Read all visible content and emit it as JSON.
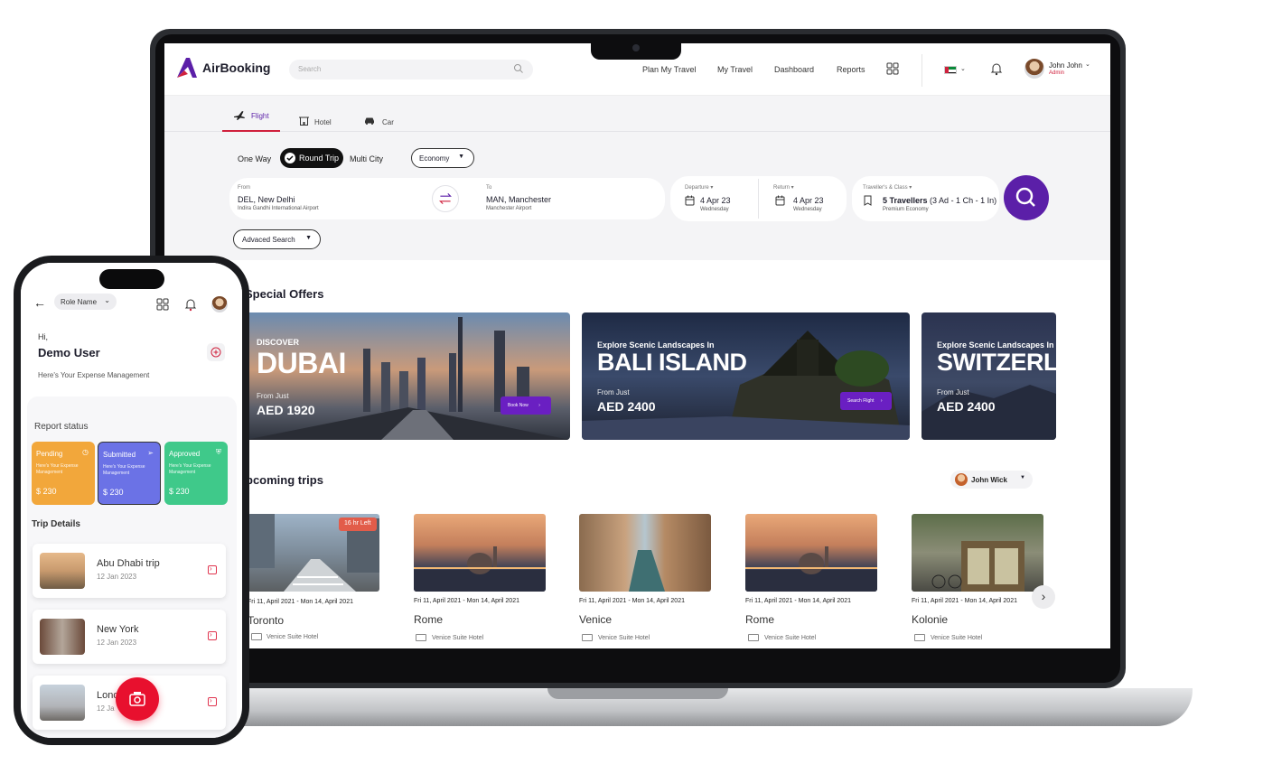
{
  "brand": {
    "name": "AirBooking",
    "accent": "#5b1fa8",
    "red": "#d0213d"
  },
  "header": {
    "search_placeholder": "Search",
    "nav": [
      "Plan My Travel",
      "My Travel",
      "Dashboard",
      "Reports"
    ],
    "user_name": "John John",
    "user_role": "Admin"
  },
  "tabs": [
    {
      "label": "Flight",
      "icon": "plane-icon",
      "active": true
    },
    {
      "label": "Hotel",
      "icon": "hotel-icon"
    },
    {
      "label": "Car",
      "icon": "car-icon"
    }
  ],
  "trip_types": {
    "one_way": "One Way",
    "round_trip": "Round Trip",
    "multi_city": "Multi City",
    "selected": "Round Trip"
  },
  "cabin": "Economy",
  "from": {
    "label": "From",
    "code_city": "DEL, New Delhi",
    "airport": "Indira Gandhi International Airport"
  },
  "to": {
    "label": "To",
    "code_city": "MAN, Manchester",
    "airport": "Manchester Airport"
  },
  "departure": {
    "label": "Departure",
    "date": "4 Apr 23",
    "day": "Wednesday"
  },
  "return": {
    "label": "Return",
    "date": "4 Apr 23",
    "day": "Wednesday"
  },
  "travellers": {
    "label": "Traveller's & Class",
    "summary_bold": "5 Travellers",
    "summary_rest": " (3 Ad - 1 Ch - 1 In)",
    "class": "Premium Economy"
  },
  "advanced_search": "Advaced Search",
  "special_offers": {
    "title": "Special Offers",
    "items": [
      {
        "small": "DISCOVER",
        "big": "DUBAI",
        "from": "From Just",
        "price": "AED 1920",
        "button": "Book Now"
      },
      {
        "small": "Explore Scenic Landscapes In",
        "big": "BALI ISLAND",
        "from": "From Just",
        "price": "AED 2400",
        "button": "Search Flight"
      },
      {
        "small": "Explore Scenic Landscapes In",
        "big": "SWITZERLA",
        "from": "From Just",
        "price": "AED 2400"
      }
    ]
  },
  "upcoming": {
    "title": "pcoming trips",
    "filter_user": "John Wick",
    "badge": "16 hr Left",
    "trips": [
      {
        "date": "Fri 11, April 2021 - Mon 14, April 2021",
        "city": "Toronto",
        "hotel": "Venice Suite Hotel"
      },
      {
        "date": "Fri 11, April 2021 - Mon 14, April 2021",
        "city": "Rome",
        "hotel": "Venice Suite Hotel"
      },
      {
        "date": "Fri 11, April 2021 - Mon 14, April 2021",
        "city": "Venice",
        "hotel": "Venice Suite Hotel"
      },
      {
        "date": "Fri 11, April 2021 - Mon 14, April 2021",
        "city": "Rome",
        "hotel": "Venice Suite Hotel"
      },
      {
        "date": "Fri 11, April 2021 - Mon 14, April 2021",
        "city": "Kolonie",
        "hotel": "Venice Suite Hotel"
      }
    ]
  },
  "phone": {
    "role_name": "Role Name",
    "greeting": "Hi,",
    "user": "Demo User",
    "subtitle": "Here's Your Expense Management",
    "report_status_title": "Report  status",
    "cards": [
      {
        "title": "Pending",
        "desc": "Here's Your Expense Management",
        "amount": "$ 230",
        "color": "#f2a73b"
      },
      {
        "title": "Submitted",
        "desc": "Here's Your Expense Management",
        "amount": "$ 230",
        "color": "#6b72e6"
      },
      {
        "title": "Approved",
        "desc": "Here's Your Expense Management",
        "amount": "$ 230",
        "color": "#3fc98a"
      }
    ],
    "trip_details_title": "Trip Details",
    "trips": [
      {
        "title": "Abu Dhabi trip",
        "date": "12 Jan 2023"
      },
      {
        "title": "New York",
        "date": "12 Jan 2023"
      },
      {
        "title": "Lond",
        "date": "12 Ja"
      }
    ]
  }
}
